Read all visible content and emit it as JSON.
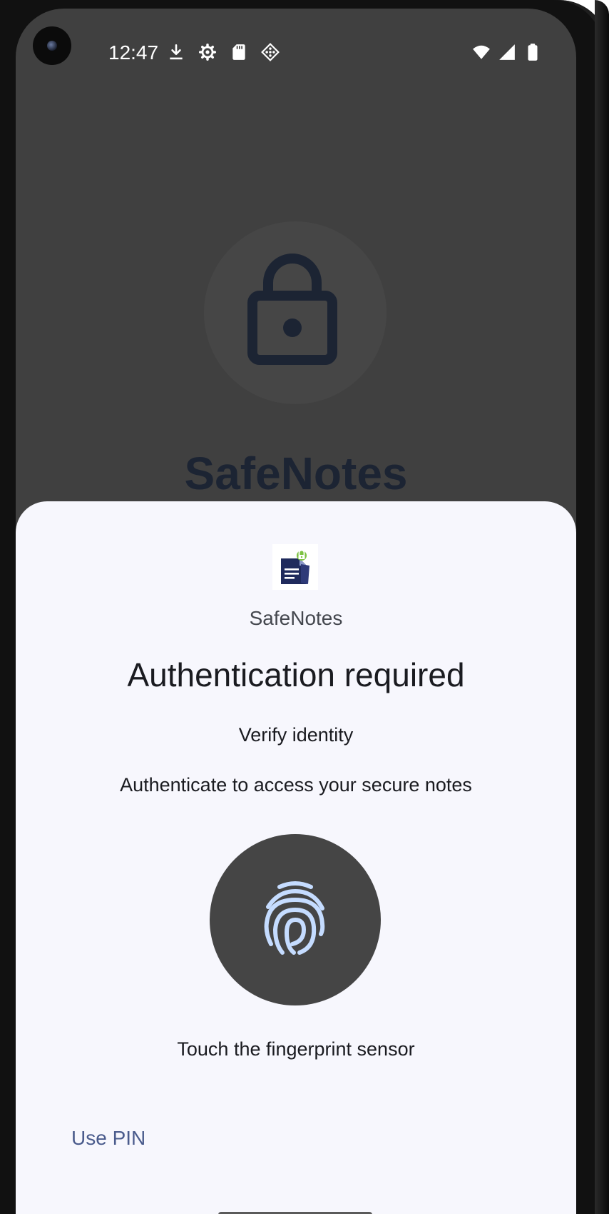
{
  "status_bar": {
    "time": "12:47",
    "left_icons": [
      "download-icon",
      "settings-icon",
      "sd-card-icon",
      "diamond-grid-icon"
    ],
    "right_icons": [
      "wifi-icon",
      "signal-icon",
      "battery-icon"
    ]
  },
  "background_app": {
    "title": "SafeNotes",
    "icon": "lock-icon"
  },
  "prompt": {
    "app_name": "SafeNotes",
    "app_logo_icon": "safenotes-logo-icon",
    "title": "Authentication required",
    "subtitle": "Verify identity",
    "description": "Authenticate to access your secure notes",
    "sensor_icon": "fingerprint-icon",
    "hint": "Touch the fingerprint sensor",
    "alternate_button_label": "Use PIN"
  },
  "colors": {
    "scrim": "#404040",
    "sheet_background": "#f7f7fd",
    "sensor_circle": "#454545",
    "fingerprint_stroke": "#c5dcff",
    "link_text": "#4a5b8c",
    "lock_dark": "#1c2433"
  }
}
